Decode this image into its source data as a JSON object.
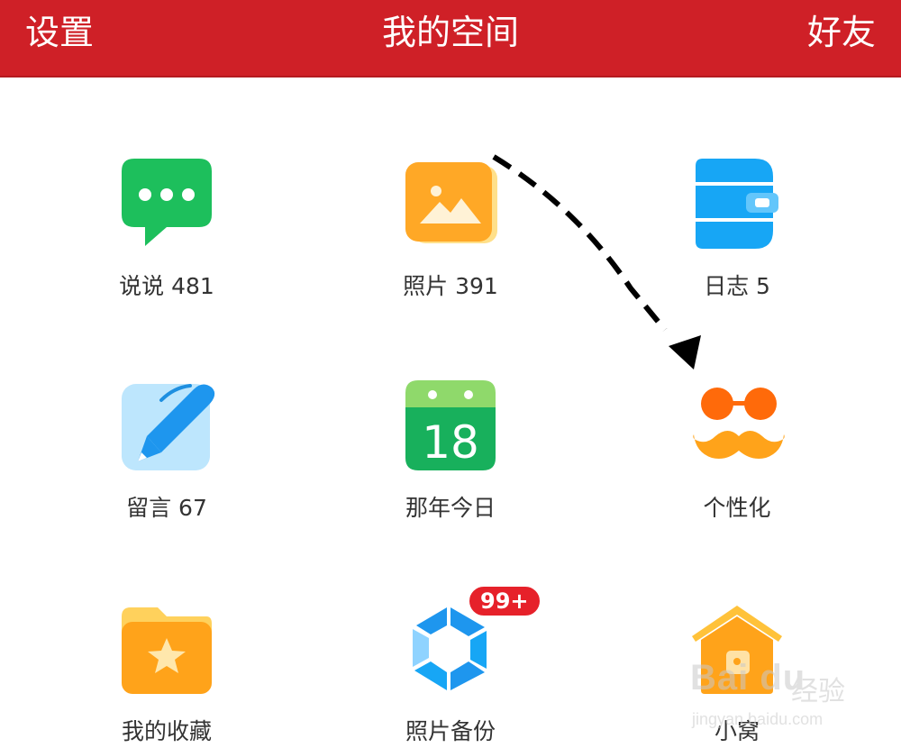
{
  "header": {
    "left_label": "设置",
    "title": "我的空间",
    "right_label": "好友",
    "background_color": "#cf2027"
  },
  "grid": {
    "items": [
      {
        "label": "说说 481",
        "icon": "speech-bubble-icon"
      },
      {
        "label": "照片 391",
        "icon": "photo-album-icon"
      },
      {
        "label": "日志 5",
        "icon": "diary-icon"
      },
      {
        "label": "留言 67",
        "icon": "pen-icon"
      },
      {
        "label": "那年今日",
        "icon": "calendar-icon",
        "icon_text": "18"
      },
      {
        "label": "个性化",
        "icon": "glasses-mustache-icon"
      },
      {
        "label": "我的收藏",
        "icon": "star-folder-icon"
      },
      {
        "label": "照片备份",
        "icon": "backup-icon",
        "badge": "99+"
      },
      {
        "label": "小窝",
        "icon": "house-icon"
      }
    ]
  },
  "watermark": {
    "brand": "Bai du",
    "brand_cn": "经验",
    "url": "jingyan.baidu.com"
  },
  "colors": {
    "accent_red": "#cf2027",
    "badge_red": "#e6212a",
    "green": "#1dbf5c",
    "orange": "#ffa31a",
    "blue": "#17a6f5"
  }
}
